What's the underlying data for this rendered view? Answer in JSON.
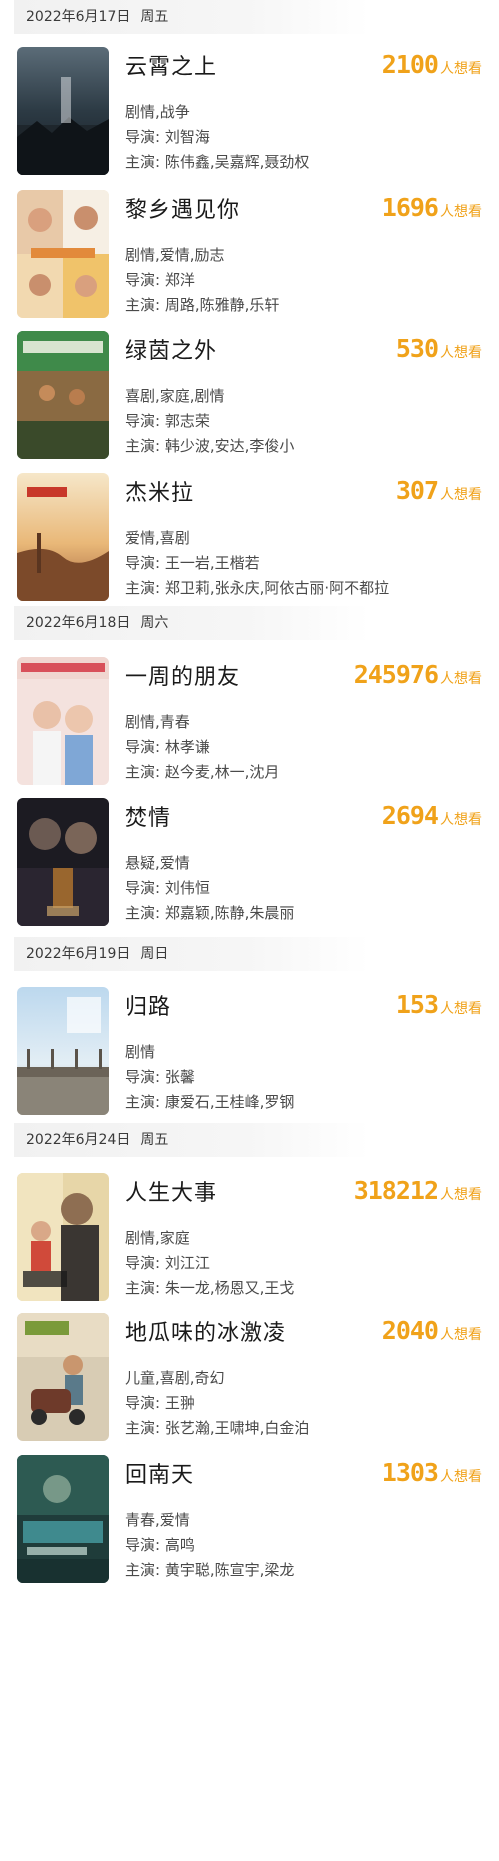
{
  "labels": {
    "director_prefix": "导演: ",
    "cast_prefix": "主演: ",
    "want_suffix": "人想看"
  },
  "colors": {
    "want_count": "#f0a21a",
    "date_bar": "#f2f2f2"
  },
  "dates": [
    {
      "date": "2022年6月17日",
      "weekday": "周五"
    },
    {
      "date": "2022年6月18日",
      "weekday": "周六"
    },
    {
      "date": "2022年6月19日",
      "weekday": "周日"
    },
    {
      "date": "2022年6月24日",
      "weekday": "周五"
    }
  ],
  "movies": [
    {
      "title": "云霄之上",
      "want": "2100",
      "genres": "剧情,战争",
      "director": "刘智海",
      "cast": "陈伟鑫,吴嘉辉,聂劲权",
      "poster_icon": "poster-image"
    },
    {
      "title": "黎乡遇见你",
      "want": "1696",
      "genres": "剧情,爱情,励志",
      "director": "郑洋",
      "cast": "周路,陈雅静,乐轩",
      "poster_icon": "poster-image"
    },
    {
      "title": "绿茵之外",
      "want": "530",
      "genres": "喜剧,家庭,剧情",
      "director": "郭志荣",
      "cast": "韩少波,安达,李俊小",
      "poster_icon": "poster-image"
    },
    {
      "title": "杰米拉",
      "want": "307",
      "genres": "爱情,喜剧",
      "director": "王一岩,王楷若",
      "cast": "郑卫莉,张永庆,阿依古丽·阿不都拉",
      "poster_icon": "poster-image"
    },
    {
      "title": "一周的朋友",
      "want": "245976",
      "genres": "剧情,青春",
      "director": "林孝谦",
      "cast": "赵今麦,林一,沈月",
      "poster_icon": "poster-image"
    },
    {
      "title": "焚情",
      "want": "2694",
      "genres": "悬疑,爱情",
      "director": "刘伟恒",
      "cast": "郑嘉颖,陈静,朱晨丽",
      "poster_icon": "poster-image"
    },
    {
      "title": "归路",
      "want": "153",
      "genres": "剧情",
      "director": "张馨",
      "cast": "康爱石,王桂峰,罗钢",
      "poster_icon": "poster-image"
    },
    {
      "title": "人生大事",
      "want": "318212",
      "genres": "剧情,家庭",
      "director": "刘江江",
      "cast": "朱一龙,杨恩又,王戈",
      "poster_icon": "poster-image"
    },
    {
      "title": "地瓜味的冰激凌",
      "want": "2040",
      "genres": "儿童,喜剧,奇幻",
      "director": "王翀",
      "cast": "张艺瀚,王啸坤,白金泊",
      "poster_icon": "poster-image"
    },
    {
      "title": "回南天",
      "want": "1303",
      "genres": "青春,爱情",
      "director": "高鸣",
      "cast": "黄宇聪,陈宣宇,梁龙",
      "poster_icon": "poster-image"
    }
  ]
}
